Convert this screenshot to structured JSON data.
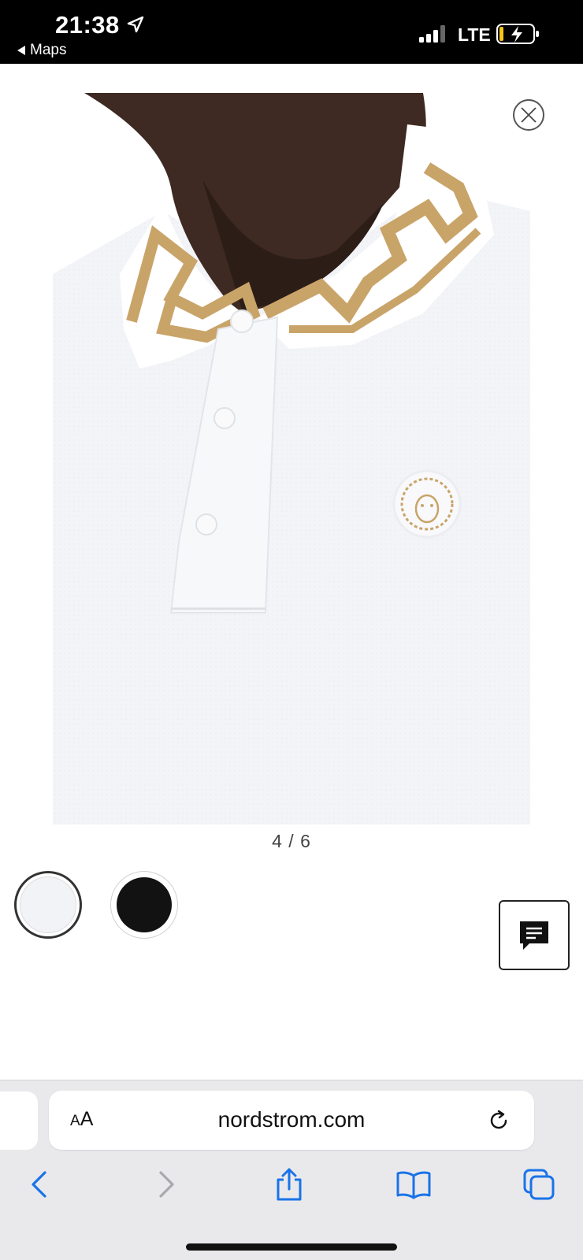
{
  "status_bar": {
    "time": "21:38",
    "back_app": "Maps",
    "network": "LTE"
  },
  "product": {
    "image_counter": "4 / 6",
    "image_icon": "polo-shirt-photo",
    "swatches": [
      {
        "name": "white",
        "color": "#f2f3f6",
        "selected": true
      },
      {
        "name": "black",
        "color": "#121212",
        "selected": false
      }
    ]
  },
  "chat": {
    "icon": "chat-bubble-icon"
  },
  "browser": {
    "aa_label_small": "A",
    "aa_label_large": "A",
    "url": "nordstrom.com"
  },
  "colors": {
    "accent": "#1a73e8",
    "disabled": "#a9a9ad",
    "collar_gold": "#c9a469",
    "shirt_white": "#f4f5f7"
  }
}
